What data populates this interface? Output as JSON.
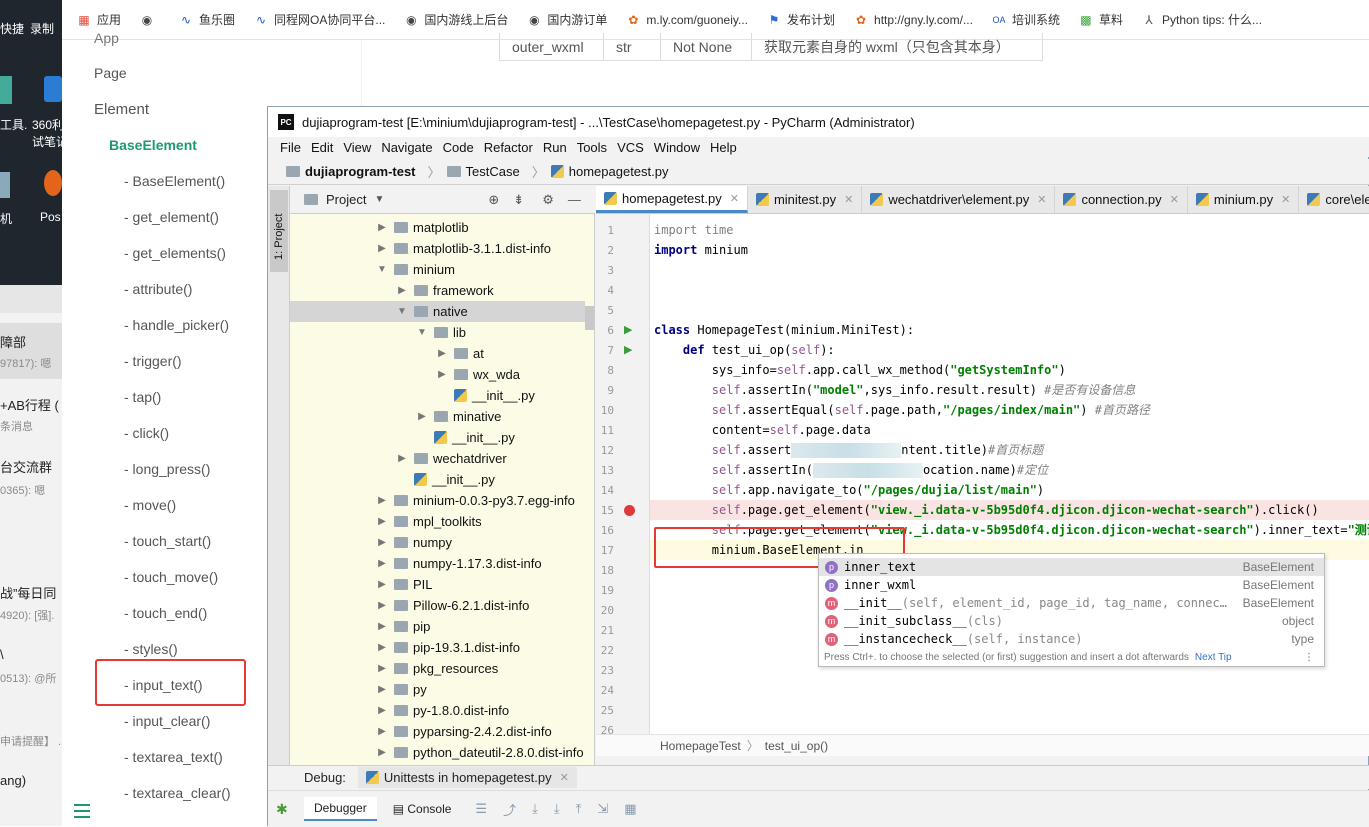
{
  "bookmarks": [
    {
      "icon": "apps-grid-icon",
      "label": "应用"
    },
    {
      "icon": "globe-icon",
      "label": ""
    },
    {
      "icon": "wave-icon",
      "label": "鱼乐圈"
    },
    {
      "icon": "wave-icon",
      "label": "同程网OA协同平台..."
    },
    {
      "icon": "globe-icon",
      "label": "国内游线上后台"
    },
    {
      "icon": "globe-icon",
      "label": "国内游订单"
    },
    {
      "icon": "leaf-icon",
      "label": "m.ly.com/guoneiy..."
    },
    {
      "icon": "flag-icon",
      "label": "发布计划"
    },
    {
      "icon": "leaf-icon",
      "label": "http://gny.ly.com/..."
    },
    {
      "icon": "oa-icon",
      "label": "培训系统"
    },
    {
      "icon": "grid-green-icon",
      "label": "草料"
    },
    {
      "icon": "python-icon",
      "label": "Python tips: 什么..."
    }
  ],
  "desktop": {
    "labels": [
      "快捷",
      "录制",
      "工具.",
      "360利",
      "试笔记",
      "机",
      "Pos"
    ],
    "chat": [
      {
        "title": "障部",
        "sub": "97817): 嗯"
      },
      {
        "title": "+AB行程 (",
        "sub": "条消息"
      },
      {
        "title": "台交流群",
        "sub": "0365): 嗯"
      },
      {
        "title": "战”每日同",
        "sub": "4920): [强]."
      },
      {
        "title": "\\",
        "sub": "0513): @所"
      },
      {
        "title": "",
        "sub": "申请提醒】 ."
      },
      {
        "title": "ang)",
        "sub": ""
      }
    ]
  },
  "docnav": {
    "top_cut": "App",
    "page": "Page",
    "element": "Element",
    "active": "BaseElement",
    "items": [
      "- BaseElement()",
      "- get_element()",
      "- get_elements()",
      "- attribute()",
      "- handle_picker()",
      "- trigger()",
      "- tap()",
      "- click()",
      "- long_press()",
      "- move()",
      "- touch_start()",
      "- touch_move()",
      "- touch_end()",
      "- styles()",
      "- input_text()",
      "- input_clear()",
      "- textarea_text()",
      "- textarea_clear()"
    ],
    "highlighted": "- input_text()"
  },
  "doctable": {
    "cells": [
      "outer_wxml",
      "str",
      "Not None",
      "获取元素自身的 wxml（只包含其本身）"
    ]
  },
  "window": {
    "title": "dujiaprogram-test [E:\\minium\\dujiaprogram-test] - ...\\TestCase\\homepagetest.py - PyCharm (Administrator)",
    "menu": [
      "File",
      "Edit",
      "View",
      "Navigate",
      "Code",
      "Refactor",
      "Run",
      "Tools",
      "VCS",
      "Window",
      "Help"
    ],
    "breadcrumbs": [
      "dujiaprogram-test",
      "TestCase",
      "homepagetest.py"
    ]
  },
  "tool_stripe": {
    "project_tab": "1: Project"
  },
  "project": {
    "header": "Project",
    "tree": [
      {
        "label": "matplotlib",
        "depth": 0,
        "kind": "folder",
        "arrow": "right"
      },
      {
        "label": "matplotlib-3.1.1.dist-info",
        "depth": 0,
        "kind": "folder",
        "arrow": "right"
      },
      {
        "label": "minium",
        "depth": 0,
        "kind": "folder",
        "arrow": "down"
      },
      {
        "label": "framework",
        "depth": 1,
        "kind": "folder",
        "arrow": "right"
      },
      {
        "label": "native",
        "depth": 1,
        "kind": "folder",
        "arrow": "down",
        "selected": true
      },
      {
        "label": "lib",
        "depth": 2,
        "kind": "folder",
        "arrow": "down"
      },
      {
        "label": "at",
        "depth": 3,
        "kind": "folder",
        "arrow": "right"
      },
      {
        "label": "wx_wda",
        "depth": 3,
        "kind": "folder",
        "arrow": "right"
      },
      {
        "label": "__init__.py",
        "depth": 3,
        "kind": "py",
        "arrow": ""
      },
      {
        "label": "minative",
        "depth": 2,
        "kind": "folder",
        "arrow": "right"
      },
      {
        "label": "__init__.py",
        "depth": 2,
        "kind": "py",
        "arrow": ""
      },
      {
        "label": "wechatdriver",
        "depth": 1,
        "kind": "folder",
        "arrow": "right"
      },
      {
        "label": "__init__.py",
        "depth": 1,
        "kind": "py",
        "arrow": ""
      },
      {
        "label": "minium-0.0.3-py3.7.egg-info",
        "depth": 0,
        "kind": "folder",
        "arrow": "right"
      },
      {
        "label": "mpl_toolkits",
        "depth": 0,
        "kind": "folder",
        "arrow": "right"
      },
      {
        "label": "numpy",
        "depth": 0,
        "kind": "folder",
        "arrow": "right"
      },
      {
        "label": "numpy-1.17.3.dist-info",
        "depth": 0,
        "kind": "folder",
        "arrow": "right"
      },
      {
        "label": "PIL",
        "depth": 0,
        "kind": "folder",
        "arrow": "right"
      },
      {
        "label": "Pillow-6.2.1.dist-info",
        "depth": 0,
        "kind": "folder",
        "arrow": "right"
      },
      {
        "label": "pip",
        "depth": 0,
        "kind": "folder",
        "arrow": "right"
      },
      {
        "label": "pip-19.3.1.dist-info",
        "depth": 0,
        "kind": "folder",
        "arrow": "right"
      },
      {
        "label": "pkg_resources",
        "depth": 0,
        "kind": "folder",
        "arrow": "right"
      },
      {
        "label": "py",
        "depth": 0,
        "kind": "folder",
        "arrow": "right"
      },
      {
        "label": "py-1.8.0.dist-info",
        "depth": 0,
        "kind": "folder",
        "arrow": "right"
      },
      {
        "label": "pyparsing-2.4.2.dist-info",
        "depth": 0,
        "kind": "folder",
        "arrow": "right"
      },
      {
        "label": "python_dateutil-2.8.0.dist-info",
        "depth": 0,
        "kind": "folder",
        "arrow": "right"
      }
    ]
  },
  "editor": {
    "tabs": [
      {
        "label": "homepagetest.py",
        "active": true
      },
      {
        "label": "minitest.py",
        "active": false
      },
      {
        "label": "wechatdriver\\element.py",
        "active": false
      },
      {
        "label": "connection.py",
        "active": false
      },
      {
        "label": "minium.py",
        "active": false
      },
      {
        "label": "core\\eleme",
        "active": false
      }
    ],
    "lines": [
      {
        "n": "1",
        "html": "<span class=\"gr\">import</span> <span class=\"gr\">time</span>"
      },
      {
        "n": "2",
        "html": "<span class=\"kw\">import</span> minium"
      },
      {
        "n": "3",
        "html": ""
      },
      {
        "n": "4",
        "html": ""
      },
      {
        "n": "5",
        "html": ""
      },
      {
        "n": "6",
        "html": "<span class=\"kw\">class</span> HomepageTest(minium.MiniTest):",
        "run": true
      },
      {
        "n": "7",
        "html": "    <span class=\"kw\">def</span> test_ui_op(<span class=\"sf\">self</span>):",
        "run": true
      },
      {
        "n": "8",
        "html": "        sys_info=<span class=\"sf\">self</span>.app.call_wx_method(<span class=\"st\">\"getSystemInfo\"</span>)"
      },
      {
        "n": "9",
        "html": "        <span class=\"sf\">self</span>.assertIn(<span class=\"st\">\"model\"</span>,sys_info.result.result) <span class=\"cm\">#是否有设备信息</span>"
      },
      {
        "n": "10",
        "html": "        <span class=\"sf\">self</span>.assertEqual(<span class=\"sf\">self</span>.page.path,<span class=\"st\">\"/pages/index/main\"</span>) <span class=\"cm\">#首页路径</span>"
      },
      {
        "n": "11",
        "html": "        content=<span class=\"sf\">self</span>.page.data"
      },
      {
        "n": "12",
        "html": "        <span class=\"sf\">self</span>.assert<span class=\"blur\"></span>ntent.title)<span class=\"cm\">#首页标题</span>"
      },
      {
        "n": "13",
        "html": "        <span class=\"sf\">self</span>.assertIn(<span class=\"blur\"></span>ocation.name)<span class=\"cm\">#定位</span>"
      },
      {
        "n": "14",
        "html": "        <span class=\"sf\">self</span>.app.navigate_to(<span class=\"st\">\"/pages/dujia/list/main\"</span>)"
      },
      {
        "n": "15",
        "html": "        <span class=\"sf\">self</span>.page.get_element(<span class=\"st\">\"view._i.data-v-5b95d0f4.djicon.djicon-wechat-search\"</span>).click()",
        "bp": true
      },
      {
        "n": "16",
        "html": "        <span class=\"sf\">self</span>.page.get_element(<span class=\"st\">\"view._i.data-v-5b95d0f4.djicon.djicon-wechat-search\"</span>).inner_text=<span class=\"st\">\"测试\"</span>"
      },
      {
        "n": "17",
        "html": "        minium.BaseElement.in",
        "cur": true
      },
      {
        "n": "18",
        "html": ""
      },
      {
        "n": "19",
        "html": ""
      },
      {
        "n": "20",
        "html": ""
      },
      {
        "n": "21",
        "html": ""
      },
      {
        "n": "22",
        "html": ""
      },
      {
        "n": "23",
        "html": ""
      },
      {
        "n": "24",
        "html": ""
      },
      {
        "n": "25",
        "html": ""
      },
      {
        "n": "26",
        "html": ""
      }
    ],
    "breadcrumb": [
      "HomepageTest",
      "test_ui_op()"
    ]
  },
  "completion": {
    "items": [
      {
        "badge": "p",
        "name": "inner_text",
        "sig": "",
        "type": "BaseElement",
        "selected": true
      },
      {
        "badge": "p",
        "name": "inner_wxml",
        "sig": "",
        "type": "BaseElement"
      },
      {
        "badge": "m",
        "name": "__init__",
        "sig": "(self, element_id, page_id, tag_name, connec…",
        "type": "BaseElement"
      },
      {
        "badge": "m",
        "name": "__init_subclass__",
        "sig": "(cls)",
        "type": "object"
      },
      {
        "badge": "m",
        "name": "__instancecheck__",
        "sig": "(self, instance)",
        "type": "type"
      }
    ],
    "footer": "Press Ctrl+. to choose the selected (or first) suggestion and insert a dot afterwards",
    "footer_link": "Next Tip"
  },
  "debug": {
    "label": "Debug:",
    "tab": "Unittests in homepagetest.py",
    "debugger": "Debugger",
    "console": "Console"
  }
}
